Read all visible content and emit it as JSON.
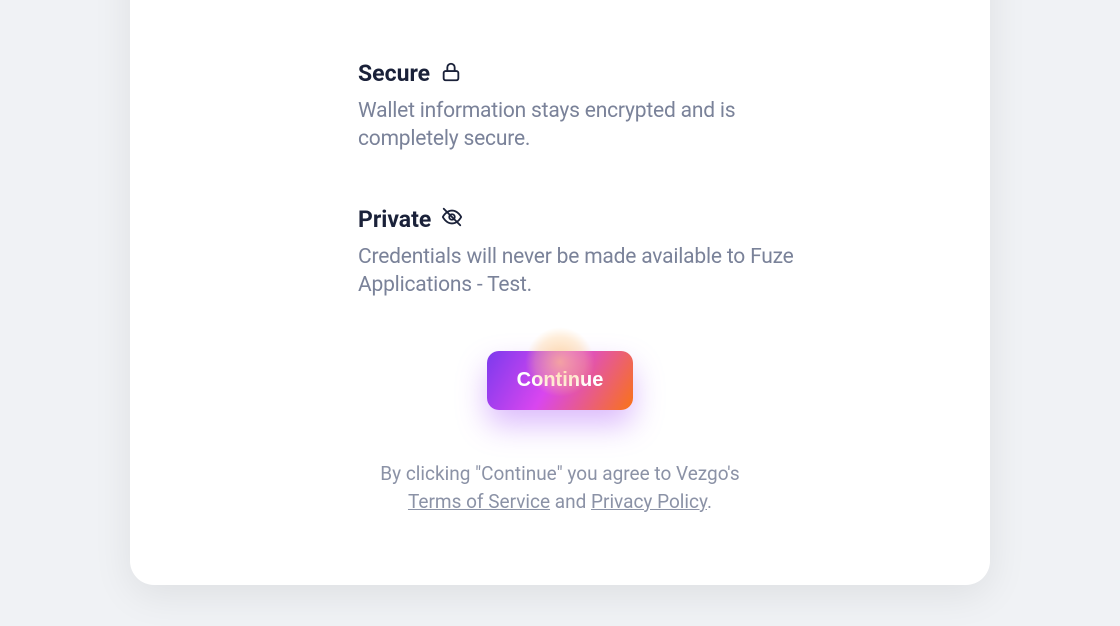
{
  "sections": {
    "secure": {
      "title": "Secure",
      "body": "Wallet information stays encrypted and is completely secure."
    },
    "private": {
      "title": "Private",
      "body": "Credentials will never be made available to Fuze Applications - Test."
    }
  },
  "button": {
    "continue_label": "Continue"
  },
  "legal": {
    "prefix": "By clicking \"Continue\" you agree to Vezgo's",
    "tos_label": "Terms of Service",
    "connector": " and ",
    "pp_label": "Privacy Policy",
    "suffix": "."
  }
}
